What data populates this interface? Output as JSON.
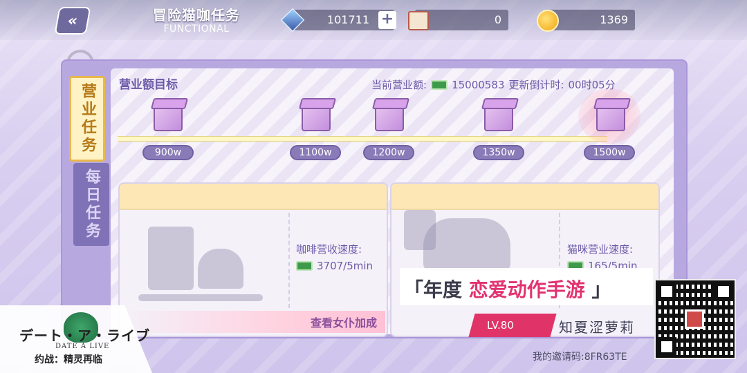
{
  "header": {
    "title_cn": "冒险猫咖任务",
    "title_en": "FUNCTIONAL",
    "back_icon": "chevron-left-icon"
  },
  "resources": {
    "crystal": "101711",
    "crystal_plus": "+",
    "ticket": "0",
    "coin": "1369"
  },
  "tabs": {
    "active": "营业任务",
    "inactive": "每日任务"
  },
  "revenue": {
    "section_title": "营业额目标",
    "current_label": "当前营业额:",
    "current_value": "15000583",
    "countdown_label": "更新倒计时:",
    "countdown_value": "00时05分"
  },
  "milestones": [
    "900w",
    "1100w",
    "1200w",
    "1350w",
    "1500w"
  ],
  "cards": {
    "coffee": {
      "speed_label": "咖啡营收速度:",
      "speed_value": "3707/5min",
      "action": "查看女仆加成"
    },
    "cat": {
      "speed_label": "猫咪营业速度:",
      "speed_value": "165/5min"
    }
  },
  "overlay": {
    "logo_jp": "デート・ア・ライブ",
    "logo_en": "DATE A LIVE",
    "logo_cn": "约战：精灵再临",
    "ad_open": "「年度",
    "ad_highlight": "恋爱动作手游",
    "ad_close": "」",
    "level": "LV.80",
    "player_name": "知夏涩萝莉",
    "invite": "我的邀请码:8FR63TE"
  },
  "colors": {
    "accent": "#6b5aa8",
    "highlight": "#e2326f",
    "tab_active_bg": "#fff3c6"
  }
}
